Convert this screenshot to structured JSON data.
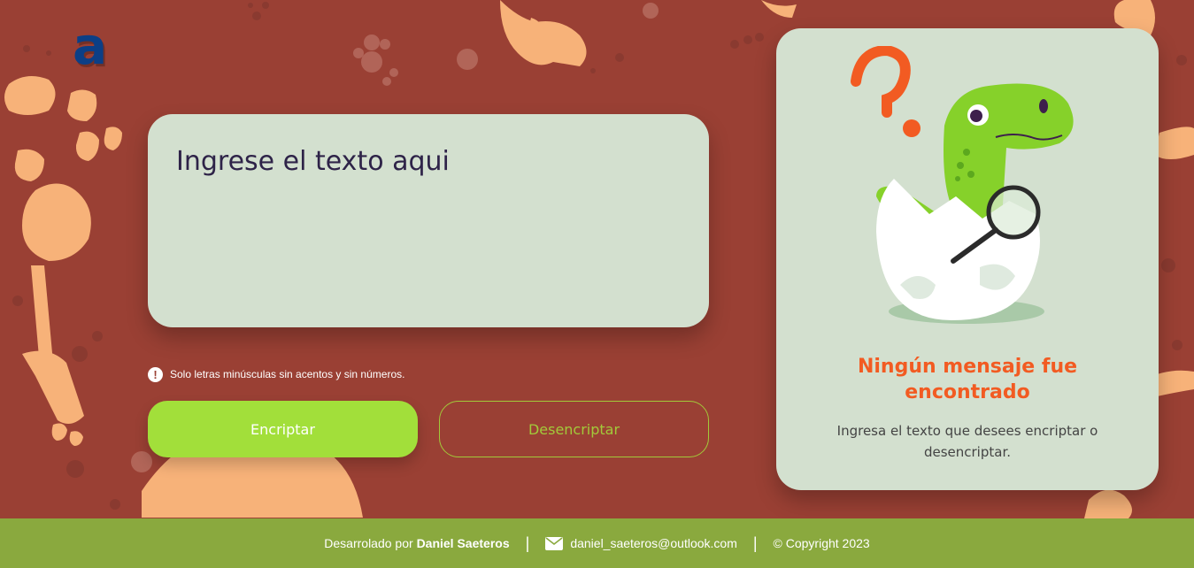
{
  "app": {
    "logo_letter": "a",
    "brand_color": "#0c3f86"
  },
  "input": {
    "placeholder": "Ingrese el texto aqui",
    "value": ""
  },
  "hint": {
    "icon": "exclamation-circle-icon",
    "text": "Solo letras minúsculas sin acentos y sin números."
  },
  "buttons": {
    "encrypt_label": "Encriptar",
    "decrypt_label": "Desencriptar"
  },
  "output": {
    "title": "Ningún mensaje fue encontrado",
    "text": "Ingresa el texto que desees encriptar o desencriptar.",
    "illustration": "dinosaur-with-magnifier-illustration"
  },
  "footer": {
    "developed_by": "Desarrolado por",
    "author": "Daniel Saeteros",
    "email": "daniel_saeteros@outlook.com",
    "copyright": "© Copyright 2023",
    "separator": "|"
  },
  "colors": {
    "background": "#9a4034",
    "card": "#d3e0cf",
    "accent": "#a2df3a",
    "footer": "#8aa93e",
    "title": "#f25b22"
  }
}
